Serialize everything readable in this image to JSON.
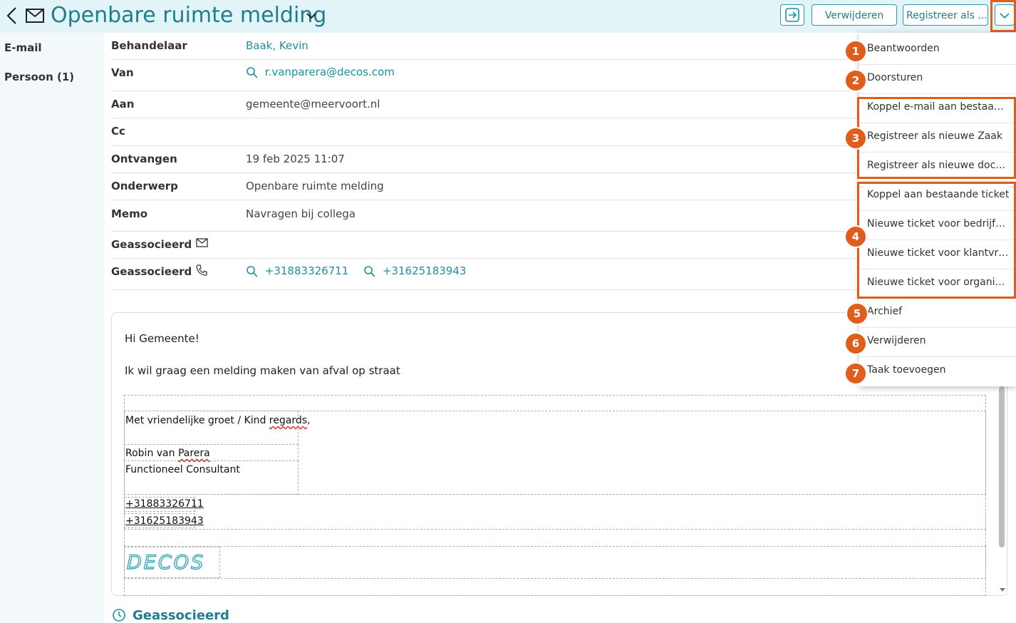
{
  "header": {
    "title": "Openbare ruimte melding",
    "buttons": {
      "delete_label": "Verwijderen",
      "register_label": "Registreer als ..."
    }
  },
  "sidebar": {
    "items": [
      {
        "label": "E-mail"
      },
      {
        "label": "Persoon (1)"
      }
    ]
  },
  "fields": {
    "behandelaar": {
      "label": "Behandelaar",
      "value": "Baak, Kevin"
    },
    "van": {
      "label": "Van",
      "value": "r.vanparera@decos.com"
    },
    "aan": {
      "label": "Aan",
      "value": "gemeente@meervoort.nl"
    },
    "cc": {
      "label": "Cc",
      "value": ""
    },
    "ontvangen": {
      "label": "Ontvangen",
      "value": "19 feb 2025 11:07"
    },
    "onderwerp": {
      "label": "Onderwerp",
      "value": "Openbare ruimte melding"
    },
    "memo": {
      "label": "Memo",
      "value": "Navragen bij collega"
    },
    "geassocieerd_mail": {
      "label": "Geassocieerd"
    },
    "geassocieerd_phone": {
      "label": "Geassocieerd",
      "phones": [
        "+31883326711",
        "+31625183943"
      ]
    }
  },
  "mail_body": {
    "greeting": "Hi Gemeente!",
    "text": "Ik wil graag een melding maken van afval op straat",
    "signature": {
      "closing_prefix": "Met vriendelijke groet / Kind ",
      "closing_word": "regards",
      "closing_suffix": ",",
      "name_prefix": "Robin van ",
      "name_word": "Parera",
      "role": "Functioneel Consultant",
      "phone1": "+31883326711",
      "phone2": "+31625183943",
      "logo": "DECOS"
    }
  },
  "footer": {
    "title": "Geassocieerd"
  },
  "menu": {
    "items": [
      {
        "label": "Beantwoorden"
      },
      {
        "label": "Doorsturen"
      },
      {
        "label": "Koppel e-mail aan bestaand..."
      },
      {
        "label": "Registreer als nieuwe Zaak"
      },
      {
        "label": "Registreer als nieuwe docum..."
      },
      {
        "label": "Koppel aan bestaande ticket"
      },
      {
        "label": "Nieuwe ticket voor bedrijfsc..."
      },
      {
        "label": "Nieuwe ticket voor klantvraag"
      },
      {
        "label": "Nieuwe ticket voor organisatie"
      },
      {
        "label": "Archief"
      },
      {
        "label": "Verwijderen"
      },
      {
        "label": "Taak toevoegen"
      }
    ],
    "badges": [
      "1",
      "2",
      "3",
      "4",
      "5",
      "6",
      "7"
    ]
  },
  "colors": {
    "accent": "#1f7e8e",
    "highlight": "#e05d1c",
    "header_bg": "#e3f4f8"
  },
  "icons": [
    "back-arrow-icon",
    "mail-icon",
    "chevron-down-icon",
    "open-external-icon",
    "search-icon",
    "phone-icon",
    "history-icon"
  ]
}
